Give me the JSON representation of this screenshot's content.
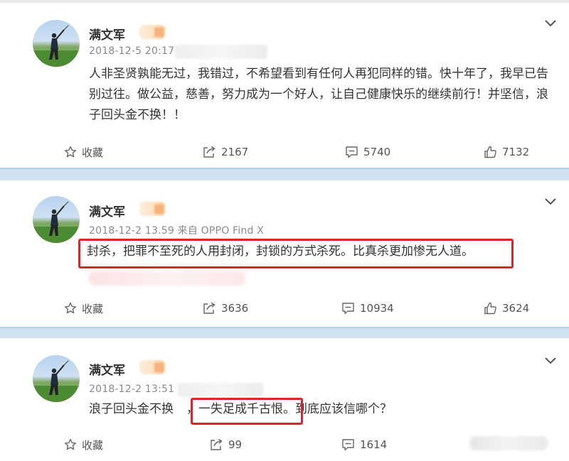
{
  "posts": [
    {
      "author": "满文军",
      "meta": "2018-12-5 20:17",
      "content": "人非圣贤孰能无过，我错过，不希望看到有任何人再犯同样的错。快十年了，我早已告别过往。做公益，慈善，努力成为一个好人，让自己健康快乐的继续前行！并坚信，浪子回头金不换！！",
      "favorite": "收藏",
      "repost": "2167",
      "comment": "5740",
      "like": "7132"
    },
    {
      "author": "满文军",
      "meta": "2018-12-2 13.59 来自 OPPO Find X",
      "content": "封杀，把罪不至死的人用封闭，封锁的方式杀死。比真杀更加惨无人道。",
      "favorite": "收藏",
      "repost": "3636",
      "comment": "10934",
      "like": "3624"
    },
    {
      "author": "满文军",
      "meta": "2018-12-2 13:51",
      "content_a": "浪子回头金不换",
      "content_b": "，一失足成千古恨。",
      "content_c": "到底应该信哪个？",
      "favorite": "收藏",
      "repost": "99",
      "comment": "1614"
    }
  ],
  "colors": {
    "highlight_box": "#d9262b",
    "separator": "#cfe1ef",
    "text": "#333333",
    "meta_text": "#8a8a8a"
  },
  "icons": [
    "chevron-down-icon",
    "star-icon",
    "repost-icon",
    "comment-icon",
    "thumb-up-icon",
    "avatar-golfer"
  ]
}
